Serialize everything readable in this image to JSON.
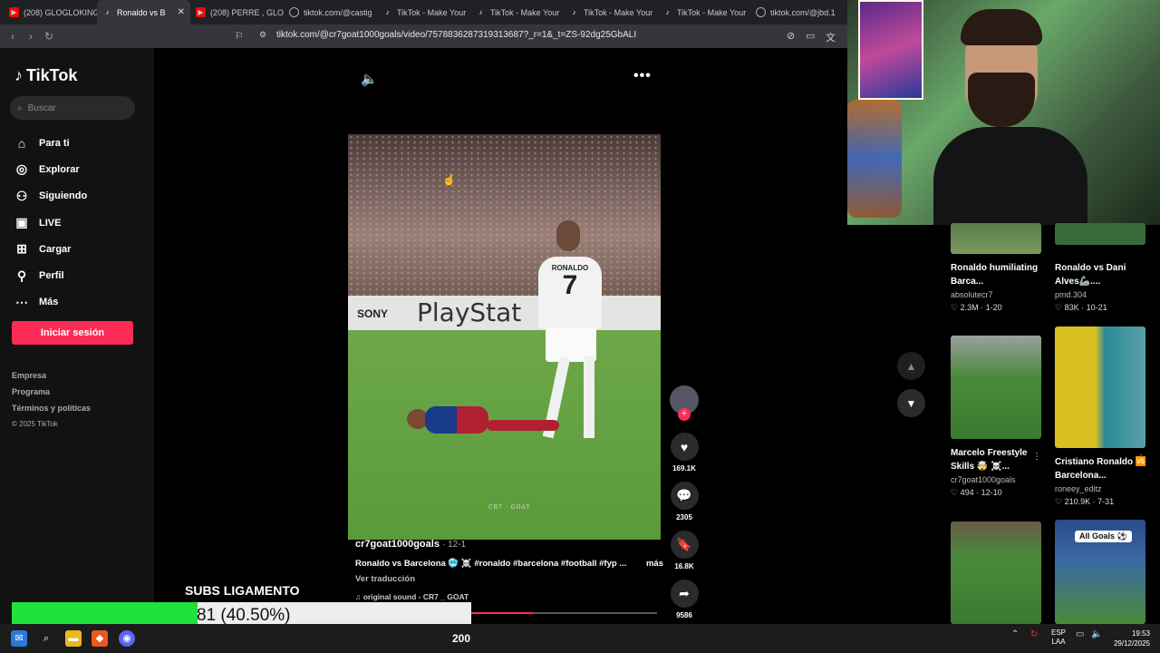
{
  "browser": {
    "tabs": [
      {
        "label": "(208) GLOGLOKING",
        "icon": "youtube-icon"
      },
      {
        "label": "Ronaldo vs B",
        "icon": "tiktok-icon",
        "active": true
      },
      {
        "label": "(208) PERRE , GLOG",
        "icon": "youtube-icon"
      },
      {
        "label": "tiktok.com/@castig",
        "icon": "globe-icon"
      },
      {
        "label": "TikTok - Make Your",
        "icon": "tiktok-icon"
      },
      {
        "label": "TikTok - Make Your",
        "icon": "tiktok-icon"
      },
      {
        "label": "TikTok - Make Your",
        "icon": "tiktok-icon"
      },
      {
        "label": "TikTok - Make Your",
        "icon": "tiktok-icon"
      },
      {
        "label": "tiktok.com/@jbd.1",
        "icon": "globe-icon"
      }
    ],
    "url": "tiktok.com/@cr7goat1000goals/video/7578836287319313687?_r=1&_t=ZS-92dg25GbALI"
  },
  "sidebar": {
    "logo": "TikTok",
    "search_placeholder": "Buscar",
    "nav": [
      {
        "label": "Para ti",
        "icon": "home-icon"
      },
      {
        "label": "Explorar",
        "icon": "compass-icon"
      },
      {
        "label": "Siguiendo",
        "icon": "following-icon"
      },
      {
        "label": "LIVE",
        "icon": "live-icon"
      },
      {
        "label": "Cargar",
        "icon": "upload-icon"
      },
      {
        "label": "Perfil",
        "icon": "profile-icon"
      },
      {
        "label": "Más",
        "icon": "more-icon"
      }
    ],
    "login": "Iniciar sesión",
    "footer": [
      "Empresa",
      "Programa",
      "Términos y políticas"
    ],
    "copyright": "© 2025 TikTok"
  },
  "video": {
    "watermark": "CR7 · GOAT",
    "board_left": "SONY",
    "board_right": "PlayStat",
    "shirt_name": "RONALDO",
    "shirt_number": "7",
    "author": "cr7goat1000goals",
    "date": "· 12-1",
    "description": "Ronaldo vs Barcelona 🥶 ☠️ #ronaldo #barcelona #football #fyp ...",
    "more": "más",
    "translate": "Ver traducción",
    "sound": "♫ original sound - CR7 _ GOAT",
    "progress": 0.33,
    "likes": "169.1K",
    "comments": "2305",
    "saves": "16.8K",
    "shares": "9586"
  },
  "related": [
    {
      "title": "Ronaldo humiliating Barca...",
      "author": "absolutecr7",
      "likes": "2.3M",
      "date": "1-20"
    },
    {
      "title": "Ronaldo vs Dani Alves🦾....",
      "author": "pmd.304",
      "likes": "83K",
      "date": "10-21"
    },
    {
      "title": "Marcelo Freestyle Skills 🤯 ☠️...",
      "author": "cr7goat1000goals",
      "likes": "494",
      "date": "12-10"
    },
    {
      "title": "Cristiano Ronaldo 🆚 Barcelona...",
      "author": "roneey_editz",
      "likes": "210.9K",
      "date": "7-31"
    },
    {
      "badge": "All Goals ⚽"
    }
  ],
  "overlay": {
    "subs_title": "SUBS LIGAMENTO",
    "progress_text": "81 (40.50%)",
    "progress_fraction": 0.405,
    "fill_color": "#21e13b"
  },
  "taskbar": {
    "count": "200",
    "lang": "ESP",
    "lang2": "LAA",
    "time": "19:53",
    "date": "29/12/2025"
  }
}
